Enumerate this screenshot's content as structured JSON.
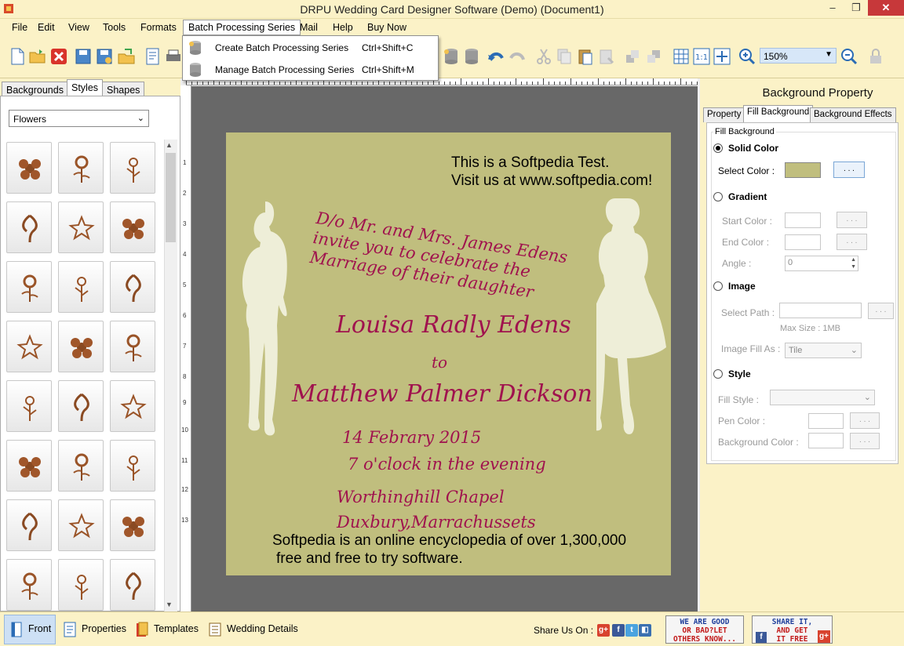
{
  "window": {
    "title": "DRPU Wedding Card Designer Software (Demo) (Document1)",
    "min": "–",
    "max": "❐",
    "close": "✕"
  },
  "menu": [
    "File",
    "Edit",
    "View",
    "Tools",
    "Formats",
    "Batch Processing Series",
    "Mail",
    "Help",
    "Buy Now"
  ],
  "dropdown": [
    {
      "label": "Create Batch Processing Series",
      "shortcut": "Ctrl+Shift+C"
    },
    {
      "label": "Manage Batch Processing Series",
      "shortcut": "Ctrl+Shift+M"
    }
  ],
  "toolbar": {
    "zoom": "150%"
  },
  "left_tabs": [
    "Backgrounds",
    "Styles",
    "Shapes"
  ],
  "category": "Flowers",
  "card": {
    "softpedia_1": "This is a Softpedia Test.",
    "softpedia_2": "Visit us at www.softpedia.com!",
    "invite_1": "D/o Mr. and Mrs. James Edens",
    "invite_2": "invite you to celebrate the",
    "invite_3": "Marriage of their daughter",
    "bride": "Louisa Radly Edens",
    "to": "to",
    "groom": "Matthew Palmer Dickson",
    "date": "14 Febrary 2015",
    "time": "7 o'clock in the evening",
    "venue": "Worthinghill Chapel",
    "city": "Duxbury,Marrachussets",
    "footer_1": "Softpedia is an online encyclopedia of over 1,300,000",
    "footer_2": "free and free to try software."
  },
  "ruler_numbers": [
    "1",
    "2",
    "3",
    "4",
    "5",
    "6",
    "7",
    "8",
    "9",
    "10",
    "11",
    "12",
    "13"
  ],
  "right_panel": {
    "title": "Background Property",
    "tabs": [
      "Property",
      "Fill Background",
      "Background Effects"
    ],
    "group": "Fill Background",
    "solid_color": "Solid Color",
    "select_color": "Select Color :",
    "dots": ". . .",
    "swatch_color": "#c0be7e",
    "gradient": "Gradient",
    "start_color": "Start Color :",
    "end_color": "End Color :",
    "angle": "Angle :",
    "angle_value": "0",
    "image": "Image",
    "select_path": "Select Path :",
    "max_size": "Max Size : 1MB",
    "image_fill_as": "Image Fill As :",
    "tile": "Tile",
    "style": "Style",
    "fill_style": "Fill Style :",
    "pen_color": "Pen Color :",
    "background_color": "Background Color :"
  },
  "statusbar": {
    "front": "Front",
    "properties": "Properties",
    "templates": "Templates",
    "wedding_details": "Wedding Details",
    "share": "Share Us On :",
    "promo1": [
      "WE ARE GOOD",
      "OR BAD?LET",
      "OTHERS KNOW..."
    ],
    "promo2": [
      "SHARE IT,",
      "AND GET",
      "IT FREE"
    ]
  }
}
